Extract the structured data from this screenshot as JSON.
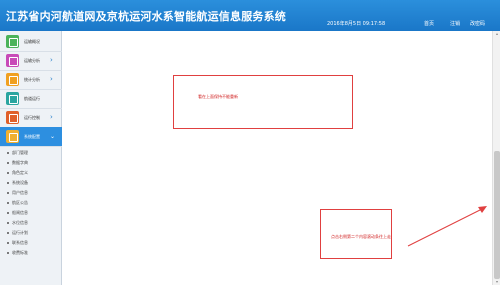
{
  "app": {
    "title": "江苏省内河航道网及京杭运河水系智能航运信息服务系统",
    "datetime": "2016年8月5日 09:17:58",
    "nav": {
      "home": "首页",
      "logout": "注销",
      "change_password": "改密码"
    }
  },
  "sidebar": {
    "items": [
      {
        "label": "运输概况",
        "icon": "list-icon",
        "color": "#4bb35a",
        "has_chevron": false
      },
      {
        "label": "运输分析",
        "icon": "chart-icon",
        "color": "#c84ab8",
        "has_chevron": true
      },
      {
        "label": "统计分析",
        "icon": "table-icon",
        "color": "#f0a020",
        "has_chevron": true
      },
      {
        "label": "航道运行",
        "icon": "ship-icon",
        "color": "#2aa5a0",
        "has_chevron": false
      },
      {
        "label": "运行控制",
        "icon": "control-icon",
        "color": "#e0602a",
        "has_chevron": true
      },
      {
        "label": "系统配置",
        "icon": "gear-icon",
        "color": "#f0b030",
        "has_chevron": true,
        "active": true
      }
    ],
    "sub_items": [
      "部门管理",
      "数据字典",
      "角色定义",
      "系统设备",
      "用户信息",
      "航区公告",
      "船闸信息",
      "水位信息",
      "运行计划",
      "联系信息",
      "收费标准"
    ]
  },
  "annotations": [
    {
      "text": "看在上面保持不能重新"
    },
    {
      "text": "点击右侧第二个内容滚动条往上走"
    }
  ],
  "colors": {
    "header": "#1a77c8",
    "annotation": "#e04040",
    "active_item": "#2d8fe0"
  }
}
